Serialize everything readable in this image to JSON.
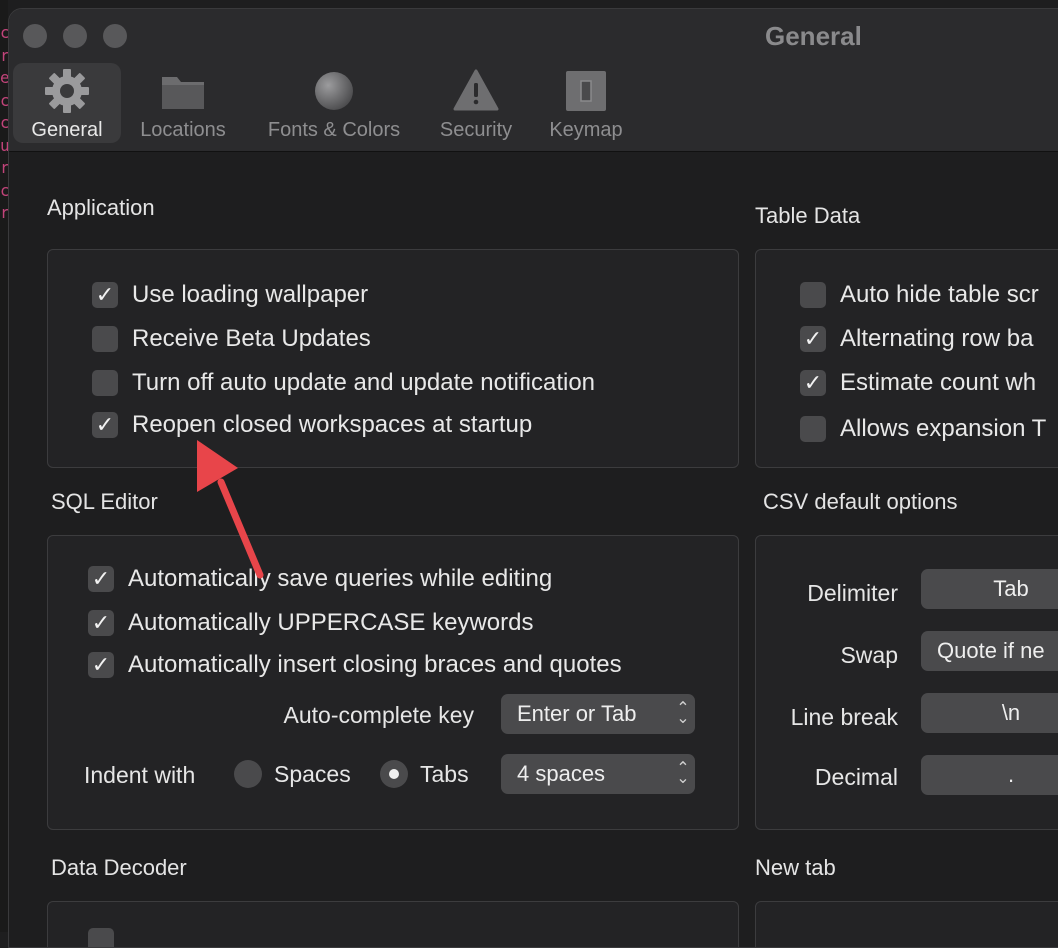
{
  "window": {
    "title": "General"
  },
  "toolbar": {
    "items": [
      {
        "label": "General",
        "icon": "gear-icon",
        "active": true
      },
      {
        "label": "Locations",
        "icon": "folder-icon",
        "active": false
      },
      {
        "label": "Fonts & Colors",
        "icon": "sphere-icon",
        "active": false
      },
      {
        "label": "Security",
        "icon": "warning-icon",
        "active": false
      },
      {
        "label": "Keymap",
        "icon": "switch-icon",
        "active": false
      }
    ]
  },
  "application": {
    "title": "Application",
    "options": [
      {
        "label": "Use loading wallpaper",
        "checked": true
      },
      {
        "label": "Receive Beta Updates",
        "checked": false
      },
      {
        "label": "Turn off auto update and update notification",
        "checked": false
      },
      {
        "label": "Reopen closed workspaces at startup",
        "checked": true
      }
    ]
  },
  "table_data": {
    "title": "Table Data",
    "options": [
      {
        "label": "Auto hide table scr",
        "checked": false
      },
      {
        "label": "Alternating row ba",
        "checked": true
      },
      {
        "label": "Estimate count wh",
        "checked": true
      },
      {
        "label": "Allows expansion T",
        "checked": false
      }
    ]
  },
  "sql_editor": {
    "title": "SQL Editor",
    "options": [
      {
        "label": "Automatically save queries while editing",
        "checked": true
      },
      {
        "label": "Automatically UPPERCASE keywords",
        "checked": true
      },
      {
        "label": "Automatically insert closing braces and quotes",
        "checked": true
      }
    ],
    "autocomplete_label": "Auto-complete key",
    "autocomplete_value": "Enter or Tab",
    "indent_label": "Indent with",
    "indent_spaces": "Spaces",
    "indent_tabs": "Tabs",
    "indent_selected": "Tabs",
    "indent_size": "4 spaces"
  },
  "csv": {
    "title": "CSV default options",
    "delimiter_label": "Delimiter",
    "delimiter_value": "Tab",
    "swap_label": "Swap",
    "swap_value": "Quote if ne",
    "linebreak_label": "Line break",
    "linebreak_value": "\\n",
    "decimal_label": "Decimal",
    "decimal_value": "."
  },
  "data_decoder": {
    "title": "Data Decoder"
  },
  "new_tab": {
    "title": "New tab"
  },
  "colors": {
    "annotation_arrow": "#e8454a",
    "background": "#1e1e1f"
  }
}
